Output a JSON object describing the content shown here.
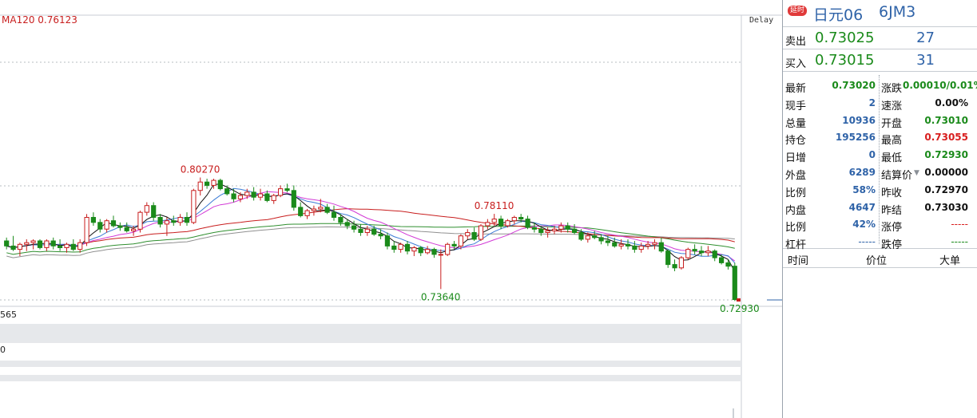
{
  "chart": {
    "ma_legend": "MA120  0.76123",
    "delay_tag": "Delay",
    "left_value_1": "565",
    "left_value_2": "0",
    "annotations": {
      "high_1": "0.80270",
      "high_2": "0.78110",
      "low_1": "0.73640",
      "low_2": "0.72930"
    },
    "colors": {
      "up": "#c81e1e",
      "down": "#1a8a1a",
      "ma_short": "#111111",
      "ma_blue": "#3b7bd6",
      "ma_magenta": "#d23ad6",
      "ma_green": "#2f8f2f",
      "ma_gray": "#909090",
      "ma_red": "#c81e1e"
    }
  },
  "chart_data": {
    "type": "candlestick",
    "title": "",
    "series": [
      {
        "name": "price",
        "ohlc": [
          [
            0.765,
            0.767,
            0.76,
            0.762
          ],
          [
            0.762,
            0.768,
            0.759,
            0.76
          ],
          [
            0.76,
            0.764,
            0.756,
            0.763
          ],
          [
            0.763,
            0.766,
            0.759,
            0.764
          ],
          [
            0.764,
            0.766,
            0.76,
            0.765
          ],
          [
            0.765,
            0.766,
            0.76,
            0.761
          ],
          [
            0.761,
            0.766,
            0.759,
            0.765
          ],
          [
            0.765,
            0.767,
            0.76,
            0.762
          ],
          [
            0.762,
            0.766,
            0.759,
            0.761
          ],
          [
            0.761,
            0.764,
            0.758,
            0.763
          ],
          [
            0.763,
            0.766,
            0.759,
            0.76
          ],
          [
            0.76,
            0.766,
            0.758,
            0.764
          ],
          [
            0.764,
            0.781,
            0.762,
            0.779
          ],
          [
            0.779,
            0.782,
            0.774,
            0.776
          ],
          [
            0.776,
            0.778,
            0.77,
            0.772
          ],
          [
            0.772,
            0.778,
            0.77,
            0.777
          ],
          [
            0.777,
            0.78,
            0.773,
            0.774
          ],
          [
            0.774,
            0.776,
            0.771,
            0.773
          ],
          [
            0.773,
            0.776,
            0.77,
            0.771
          ],
          [
            0.771,
            0.774,
            0.768,
            0.772
          ],
          [
            0.772,
            0.783,
            0.77,
            0.782
          ],
          [
            0.782,
            0.788,
            0.78,
            0.786
          ],
          [
            0.786,
            0.788,
            0.777,
            0.779
          ],
          [
            0.779,
            0.781,
            0.773,
            0.775
          ],
          [
            0.775,
            0.779,
            0.768,
            0.777
          ],
          [
            0.777,
            0.78,
            0.774,
            0.776
          ],
          [
            0.776,
            0.781,
            0.774,
            0.779
          ],
          [
            0.779,
            0.782,
            0.774,
            0.776
          ],
          [
            0.776,
            0.796,
            0.775,
            0.795
          ],
          [
            0.795,
            0.8027,
            0.792,
            0.8
          ],
          [
            0.8,
            0.802,
            0.796,
            0.798
          ],
          [
            0.798,
            0.802,
            0.796,
            0.801
          ],
          [
            0.801,
            0.802,
            0.795,
            0.796
          ],
          [
            0.796,
            0.798,
            0.792,
            0.793
          ],
          [
            0.793,
            0.796,
            0.788,
            0.79
          ],
          [
            0.79,
            0.794,
            0.788,
            0.792
          ],
          [
            0.792,
            0.796,
            0.79,
            0.794
          ],
          [
            0.794,
            0.797,
            0.789,
            0.791
          ],
          [
            0.791,
            0.796,
            0.789,
            0.793
          ],
          [
            0.793,
            0.795,
            0.788,
            0.789
          ],
          [
            0.789,
            0.793,
            0.787,
            0.792
          ],
          [
            0.792,
            0.798,
            0.791,
            0.796
          ],
          [
            0.796,
            0.799,
            0.794,
            0.795
          ],
          [
            0.795,
            0.798,
            0.783,
            0.785
          ],
          [
            0.785,
            0.788,
            0.779,
            0.78
          ],
          [
            0.78,
            0.784,
            0.778,
            0.783
          ],
          [
            0.783,
            0.786,
            0.78,
            0.784
          ],
          [
            0.784,
            0.79,
            0.782,
            0.785
          ],
          [
            0.785,
            0.787,
            0.781,
            0.782
          ],
          [
            0.782,
            0.786,
            0.777,
            0.779
          ],
          [
            0.779,
            0.781,
            0.774,
            0.776
          ],
          [
            0.776,
            0.778,
            0.772,
            0.774
          ],
          [
            0.774,
            0.777,
            0.77,
            0.772
          ],
          [
            0.772,
            0.775,
            0.768,
            0.77
          ],
          [
            0.77,
            0.774,
            0.768,
            0.772
          ],
          [
            0.772,
            0.774,
            0.768,
            0.769
          ],
          [
            0.769,
            0.772,
            0.766,
            0.768
          ],
          [
            0.768,
            0.77,
            0.76,
            0.762
          ],
          [
            0.762,
            0.765,
            0.758,
            0.76
          ],
          [
            0.76,
            0.764,
            0.758,
            0.763
          ],
          [
            0.763,
            0.765,
            0.757,
            0.759
          ],
          [
            0.759,
            0.762,
            0.756,
            0.761
          ],
          [
            0.761,
            0.762,
            0.756,
            0.758
          ],
          [
            0.758,
            0.762,
            0.757,
            0.76
          ],
          [
            0.76,
            0.761,
            0.755,
            0.757
          ],
          [
            0.757,
            0.76,
            0.7364,
            0.757
          ],
          [
            0.757,
            0.764,
            0.756,
            0.763
          ],
          [
            0.763,
            0.765,
            0.76,
            0.762
          ],
          [
            0.762,
            0.769,
            0.76,
            0.768
          ],
          [
            0.768,
            0.772,
            0.766,
            0.77
          ],
          [
            0.77,
            0.773,
            0.765,
            0.766
          ],
          [
            0.766,
            0.775,
            0.765,
            0.774
          ],
          [
            0.774,
            0.778,
            0.772,
            0.776
          ],
          [
            0.776,
            0.7811,
            0.774,
            0.778
          ],
          [
            0.778,
            0.78,
            0.772,
            0.774
          ],
          [
            0.774,
            0.778,
            0.773,
            0.777
          ],
          [
            0.777,
            0.78,
            0.775,
            0.779
          ],
          [
            0.779,
            0.7811,
            0.776,
            0.778
          ],
          [
            0.778,
            0.78,
            0.772,
            0.773
          ],
          [
            0.773,
            0.776,
            0.77,
            0.772
          ],
          [
            0.772,
            0.774,
            0.768,
            0.77
          ],
          [
            0.77,
            0.773,
            0.767,
            0.771
          ],
          [
            0.771,
            0.774,
            0.769,
            0.772
          ],
          [
            0.772,
            0.776,
            0.77,
            0.774
          ],
          [
            0.774,
            0.776,
            0.77,
            0.772
          ],
          [
            0.772,
            0.775,
            0.769,
            0.77
          ],
          [
            0.77,
            0.772,
            0.765,
            0.766
          ],
          [
            0.766,
            0.77,
            0.764,
            0.768
          ],
          [
            0.768,
            0.771,
            0.766,
            0.767
          ],
          [
            0.767,
            0.769,
            0.763,
            0.765
          ],
          [
            0.765,
            0.768,
            0.762,
            0.764
          ],
          [
            0.764,
            0.767,
            0.761,
            0.762
          ],
          [
            0.762,
            0.766,
            0.76,
            0.763
          ],
          [
            0.763,
            0.766,
            0.76,
            0.762
          ],
          [
            0.762,
            0.765,
            0.758,
            0.76
          ],
          [
            0.76,
            0.764,
            0.758,
            0.762
          ],
          [
            0.762,
            0.765,
            0.76,
            0.763
          ],
          [
            0.763,
            0.766,
            0.76,
            0.764
          ],
          [
            0.764,
            0.767,
            0.758,
            0.759
          ],
          [
            0.759,
            0.76,
            0.749,
            0.751
          ],
          [
            0.751,
            0.754,
            0.747,
            0.749
          ],
          [
            0.749,
            0.756,
            0.748,
            0.755
          ],
          [
            0.755,
            0.761,
            0.754,
            0.76
          ],
          [
            0.76,
            0.763,
            0.757,
            0.759
          ],
          [
            0.759,
            0.762,
            0.756,
            0.758
          ],
          [
            0.758,
            0.762,
            0.756,
            0.759
          ],
          [
            0.759,
            0.76,
            0.753,
            0.755
          ],
          [
            0.755,
            0.757,
            0.751,
            0.752
          ],
          [
            0.752,
            0.754,
            0.748,
            0.75
          ],
          [
            0.75,
            0.752,
            0.7293,
            0.7302
          ]
        ]
      }
    ],
    "ma_lines": [
      "MA5",
      "MA10",
      "MA20",
      "MA60",
      "MA120",
      "MA250"
    ],
    "ma120_value": 0.76123,
    "ylim": [
      0.729,
      0.811
    ],
    "grid": "dashed-horizontal"
  },
  "quote": {
    "delay_badge": "延时",
    "name": "日元06",
    "code": "6JM3",
    "ask_label": "卖出",
    "ask_price": "0.73025",
    "ask_vol": "27",
    "bid_label": "买入",
    "bid_price": "0.73015",
    "bid_vol": "31",
    "stats": [
      {
        "l_label": "最新",
        "l_val": "0.73020",
        "l_color": "c-green",
        "r_label": "涨跌",
        "r_val": "0.00010/0.01%",
        "r_color": "c-green"
      },
      {
        "l_label": "现手",
        "l_val": "2",
        "l_color": "c-blue",
        "r_label": "速涨",
        "r_val": "0.00%",
        "r_color": "c-black"
      },
      {
        "l_label": "总量",
        "l_val": "10936",
        "l_color": "c-blue",
        "r_label": "开盘",
        "r_val": "0.73010",
        "r_color": "c-green"
      },
      {
        "l_label": "持仓",
        "l_val": "195256",
        "l_color": "c-blue",
        "r_label": "最高",
        "r_val": "0.73055",
        "r_color": "c-red"
      },
      {
        "l_label": "日增",
        "l_val": "0",
        "l_color": "c-blue",
        "r_label": "最低",
        "r_val": "0.72930",
        "r_color": "c-green"
      },
      {
        "l_label": "外盘",
        "l_val": "6289",
        "l_color": "c-blue",
        "r_label": "结算价",
        "r_val": "0.00000",
        "r_color": "c-black"
      },
      {
        "l_label": "比例",
        "l_val": "58%",
        "l_color": "c-blue",
        "r_label": "昨收",
        "r_val": "0.72970",
        "r_color": "c-black"
      },
      {
        "l_label": "内盘",
        "l_val": "4647",
        "l_color": "c-blue",
        "r_label": "昨结",
        "r_val": "0.73030",
        "r_color": "c-black"
      },
      {
        "l_label": "比例",
        "l_val": "42%",
        "l_color": "c-blue",
        "r_label": "涨停",
        "r_val": "-----",
        "r_color": "c-dash"
      },
      {
        "l_label": "杠杆",
        "l_val": "-----",
        "l_color": "c-dash-blue",
        "r_label": "跌停",
        "r_val": "-----",
        "r_color": "c-dash-green"
      }
    ],
    "trades_header": {
      "time": "时间",
      "price": "价位",
      "size": "大单"
    }
  }
}
